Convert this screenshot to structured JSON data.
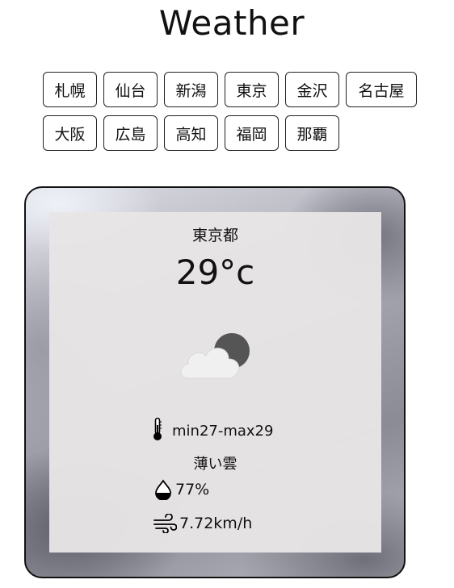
{
  "app": {
    "title": "Weather"
  },
  "cities": {
    "row1": [
      "札幌",
      "仙台",
      "新潟",
      "東京",
      "金沢",
      "名古屋"
    ],
    "row2": [
      "大阪",
      "広島",
      "高知",
      "福岡",
      "那覇"
    ]
  },
  "weather": {
    "place": "東京都",
    "temperature": "29°c",
    "icon": "cloudy-icon",
    "minmax": "min27-max29",
    "description": "薄い雲",
    "humidity": "77%",
    "wind": "7.72km/h"
  },
  "icons": {
    "thermometer": "thermometer-icon",
    "humidity": "humidity-drop-icon",
    "wind": "wind-icon"
  }
}
